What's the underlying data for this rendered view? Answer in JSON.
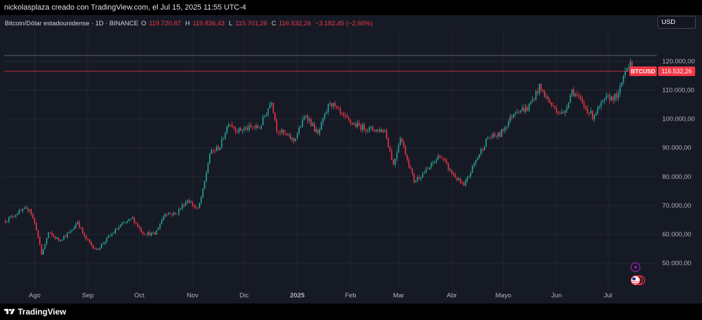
{
  "header": {
    "text": "nickolasplaza creado con TradingView.com, el Jul 15, 2025 11:55 UTC-4"
  },
  "legend": {
    "symbol": "Bitcoin/Dólar estadounidense · 1D · BINANCE",
    "open_label": "O",
    "open": "119.720,87",
    "high_label": "H",
    "high": "119.836,43",
    "low_label": "L",
    "low": "115.701,26",
    "close_label": "C",
    "close": "116.532,26",
    "change": "−3.182,45 (−2,66%)"
  },
  "currency": "USD",
  "price_badge": {
    "ticker": "BTCUSD",
    "price": "116.532,26"
  },
  "footer": {
    "brand": "TradingView"
  },
  "colors": {
    "up": "#26a69a",
    "down": "#f23645",
    "background": "#161a25",
    "grid": "#232733",
    "axis_text": "#b2b5be",
    "price_line": "#f23645",
    "high_line": "#787b86",
    "event_purple": "#9c27b0"
  },
  "icons": [
    "lightning-icon",
    "us-flag-icon",
    "tradingview-logo-icon"
  ],
  "chart_data": {
    "type": "candlestick",
    "title": "Bitcoin/Dólar estadounidense · 1D · BINANCE",
    "xlabel": "",
    "ylabel": "",
    "ylim": [
      42000,
      127500
    ],
    "y_ticks": [
      "50.000,00",
      "60.000,00",
      "70.000,00",
      "80.000,00",
      "90.000,00",
      "100.000,00",
      "110.000,00",
      "120.000,00"
    ],
    "y_tick_values": [
      50000,
      60000,
      70000,
      80000,
      90000,
      100000,
      110000,
      120000
    ],
    "x_start": "2024-07-15",
    "x_end": "2025-07-15",
    "x_ticks": [
      {
        "label": "Ago",
        "date": "2024-08-01"
      },
      {
        "label": "Sep",
        "date": "2024-09-01"
      },
      {
        "label": "Oct",
        "date": "2024-10-01"
      },
      {
        "label": "Nov",
        "date": "2024-11-01"
      },
      {
        "label": "Dic",
        "date": "2024-12-01"
      },
      {
        "label": "2025",
        "date": "2025-01-01"
      },
      {
        "label": "Feb",
        "date": "2025-02-01"
      },
      {
        "label": "Mar",
        "date": "2025-03-01"
      },
      {
        "label": "Abr",
        "date": "2025-04-01"
      },
      {
        "label": "Mayo",
        "date": "2025-05-01"
      },
      {
        "label": "Jun",
        "date": "2025-06-01"
      },
      {
        "label": "Jul",
        "date": "2025-07-01"
      }
    ],
    "current_price": 116532.26,
    "recent_high": 122000,
    "grid": true,
    "closes": [
      {
        "date": "2024-07-15",
        "close": 64700
      },
      {
        "date": "2024-07-22",
        "close": 67500
      },
      {
        "date": "2024-07-29",
        "close": 69000
      },
      {
        "date": "2024-08-02",
        "close": 62000
      },
      {
        "date": "2024-08-05",
        "close": 53000
      },
      {
        "date": "2024-08-09",
        "close": 60500
      },
      {
        "date": "2024-08-15",
        "close": 58000
      },
      {
        "date": "2024-08-22",
        "close": 60800
      },
      {
        "date": "2024-08-26",
        "close": 64500
      },
      {
        "date": "2024-08-30",
        "close": 59000
      },
      {
        "date": "2024-09-06",
        "close": 54500
      },
      {
        "date": "2024-09-13",
        "close": 59000
      },
      {
        "date": "2024-09-20",
        "close": 63000
      },
      {
        "date": "2024-09-27",
        "close": 65500
      },
      {
        "date": "2024-10-03",
        "close": 60500
      },
      {
        "date": "2024-10-10",
        "close": 60000
      },
      {
        "date": "2024-10-16",
        "close": 67500
      },
      {
        "date": "2024-10-22",
        "close": 67000
      },
      {
        "date": "2024-10-29",
        "close": 72000
      },
      {
        "date": "2024-11-04",
        "close": 68500
      },
      {
        "date": "2024-11-07",
        "close": 75000
      },
      {
        "date": "2024-11-11",
        "close": 88000
      },
      {
        "date": "2024-11-17",
        "close": 90500
      },
      {
        "date": "2024-11-22",
        "close": 99000
      },
      {
        "date": "2024-11-27",
        "close": 96000
      },
      {
        "date": "2024-12-05",
        "close": 97000
      },
      {
        "date": "2024-12-10",
        "close": 97000
      },
      {
        "date": "2024-12-17",
        "close": 106500
      },
      {
        "date": "2024-12-20",
        "close": 96500
      },
      {
        "date": "2024-12-30",
        "close": 92500
      },
      {
        "date": "2025-01-06",
        "close": 101500
      },
      {
        "date": "2025-01-13",
        "close": 94500
      },
      {
        "date": "2025-01-20",
        "close": 106000
      },
      {
        "date": "2025-01-27",
        "close": 101000
      },
      {
        "date": "2025-02-03",
        "close": 98000
      },
      {
        "date": "2025-02-12",
        "close": 96500
      },
      {
        "date": "2025-02-21",
        "close": 96000
      },
      {
        "date": "2025-02-26",
        "close": 84000
      },
      {
        "date": "2025-03-02",
        "close": 94000
      },
      {
        "date": "2025-03-10",
        "close": 78500
      },
      {
        "date": "2025-03-18",
        "close": 82500
      },
      {
        "date": "2025-03-25",
        "close": 87500
      },
      {
        "date": "2025-03-31",
        "close": 82000
      },
      {
        "date": "2025-04-08",
        "close": 76500
      },
      {
        "date": "2025-04-14",
        "close": 84500
      },
      {
        "date": "2025-04-22",
        "close": 93500
      },
      {
        "date": "2025-04-29",
        "close": 94500
      },
      {
        "date": "2025-05-08",
        "close": 103000
      },
      {
        "date": "2025-05-15",
        "close": 103500
      },
      {
        "date": "2025-05-22",
        "close": 111000
      },
      {
        "date": "2025-05-30",
        "close": 104000
      },
      {
        "date": "2025-06-05",
        "close": 101500
      },
      {
        "date": "2025-06-10",
        "close": 110000
      },
      {
        "date": "2025-06-17",
        "close": 104500
      },
      {
        "date": "2025-06-22",
        "close": 101000
      },
      {
        "date": "2025-06-30",
        "close": 107000
      },
      {
        "date": "2025-07-07",
        "close": 108000
      },
      {
        "date": "2025-07-11",
        "close": 117500
      },
      {
        "date": "2025-07-14",
        "close": 119800
      },
      {
        "date": "2025-07-15",
        "close": 116532
      }
    ]
  }
}
